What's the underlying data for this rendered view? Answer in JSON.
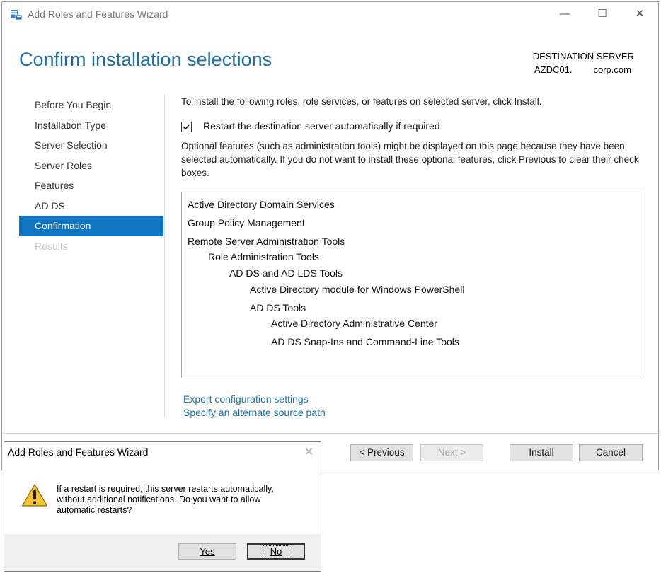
{
  "window": {
    "title": "Add Roles and Features Wizard",
    "minimize": "—",
    "maximize": "☐",
    "close": "✕"
  },
  "header": {
    "page_title": "Confirm installation selections",
    "destination_label": "DESTINATION SERVER",
    "destination_prefix": "AZDC01.",
    "destination_suffix": "corp.com"
  },
  "nav": {
    "items": [
      {
        "label": "Before You Begin",
        "state": "normal"
      },
      {
        "label": "Installation Type",
        "state": "normal"
      },
      {
        "label": "Server Selection",
        "state": "normal"
      },
      {
        "label": "Server Roles",
        "state": "normal"
      },
      {
        "label": "Features",
        "state": "normal"
      },
      {
        "label": "AD DS",
        "state": "normal"
      },
      {
        "label": "Confirmation",
        "state": "active"
      },
      {
        "label": "Results",
        "state": "disabled"
      }
    ]
  },
  "content": {
    "intro": "To install the following roles, role services, or features on selected server, click Install.",
    "restart_checkbox": {
      "label": "Restart the destination server automatically if required",
      "checked": true
    },
    "optional_text": "Optional features (such as administration tools) might be displayed on this page because they have been selected automatically. If you do not want to install these optional features, click Previous to clear their check boxes.",
    "features": [
      {
        "label": "Active Directory Domain Services",
        "level": 0
      },
      {
        "label": "Group Policy Management",
        "level": 0
      },
      {
        "label": "Remote Server Administration Tools",
        "level": 0
      },
      {
        "label": "Role Administration Tools",
        "level": 1
      },
      {
        "label": "AD DS and AD LDS Tools",
        "level": 2
      },
      {
        "label": "Active Directory module for Windows PowerShell",
        "level": 3
      },
      {
        "label": "AD DS Tools",
        "level": 3
      },
      {
        "label": "Active Directory Administrative Center",
        "level": 4
      },
      {
        "label": "AD DS Snap-Ins and Command-Line Tools",
        "level": 4
      }
    ],
    "export_link": "Export configuration settings",
    "alternate_link": "Specify an alternate source path"
  },
  "buttons": {
    "previous": "< Previous",
    "next": "Next >",
    "install": "Install",
    "cancel": "Cancel"
  },
  "dialog": {
    "title": "Add Roles and Features Wizard",
    "close": "✕",
    "message": "If a restart is required, this server restarts automatically,\nwithout additional notifications. Do you want to allow\nautomatic restarts?",
    "yes": "Yes",
    "no": "No"
  },
  "colors": {
    "accent": "#1e6fa8",
    "nav_active": "#0f75c0"
  }
}
